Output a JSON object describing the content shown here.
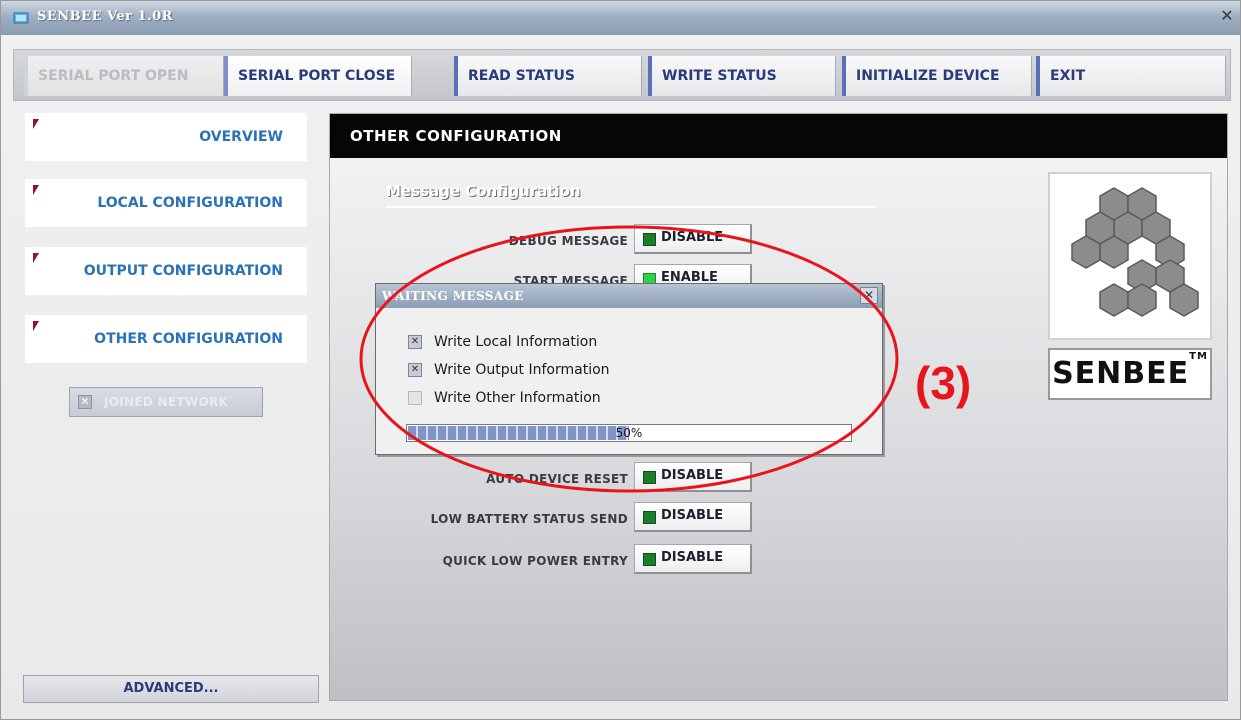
{
  "window": {
    "title": "SENBEE Ver 1.0R"
  },
  "toolbar": {
    "serial_open": "SERIAL PORT OPEN",
    "serial_close": "SERIAL PORT CLOSE",
    "read_status": "READ STATUS",
    "write_status": "WRITE STATUS",
    "initialize": "INITIALIZE DEVICE",
    "exit": "EXIT"
  },
  "sidebar": {
    "items": [
      {
        "label": "OVERVIEW"
      },
      {
        "label": "LOCAL CONFIGURATION"
      },
      {
        "label": "OUTPUT CONFIGURATION"
      },
      {
        "label": "OTHER CONFIGURATION"
      }
    ],
    "joined_network": "JOINED NETWORK",
    "advanced": "ADVANCED..."
  },
  "main": {
    "header": "OTHER CONFIGURATION",
    "section_title": "Message Configuration",
    "settings": [
      {
        "label": "DEBUG MESSAGE",
        "value": "DISABLE"
      },
      {
        "label": "START MESSAGE",
        "value": "ENABLE"
      },
      {
        "label": "AUTO DEVICE RESET",
        "value": "DISABLE"
      },
      {
        "label": "LOW BATTERY STATUS SEND",
        "value": "DISABLE"
      },
      {
        "label": "QUICK LOW POWER ENTRY",
        "value": "DISABLE"
      }
    ],
    "brand": "SENBEE",
    "brand_tm": "TM"
  },
  "dialog": {
    "title": "WAITING MESSAGE",
    "items": [
      {
        "label": "Write Local Information",
        "checked": true
      },
      {
        "label": "Write Output Information",
        "checked": true
      },
      {
        "label": "Write Other Information",
        "checked": false
      }
    ],
    "progress_text": "50%",
    "progress_value": 0.5
  },
  "annotation": {
    "step": "(3)",
    "color": "#e8141c"
  }
}
